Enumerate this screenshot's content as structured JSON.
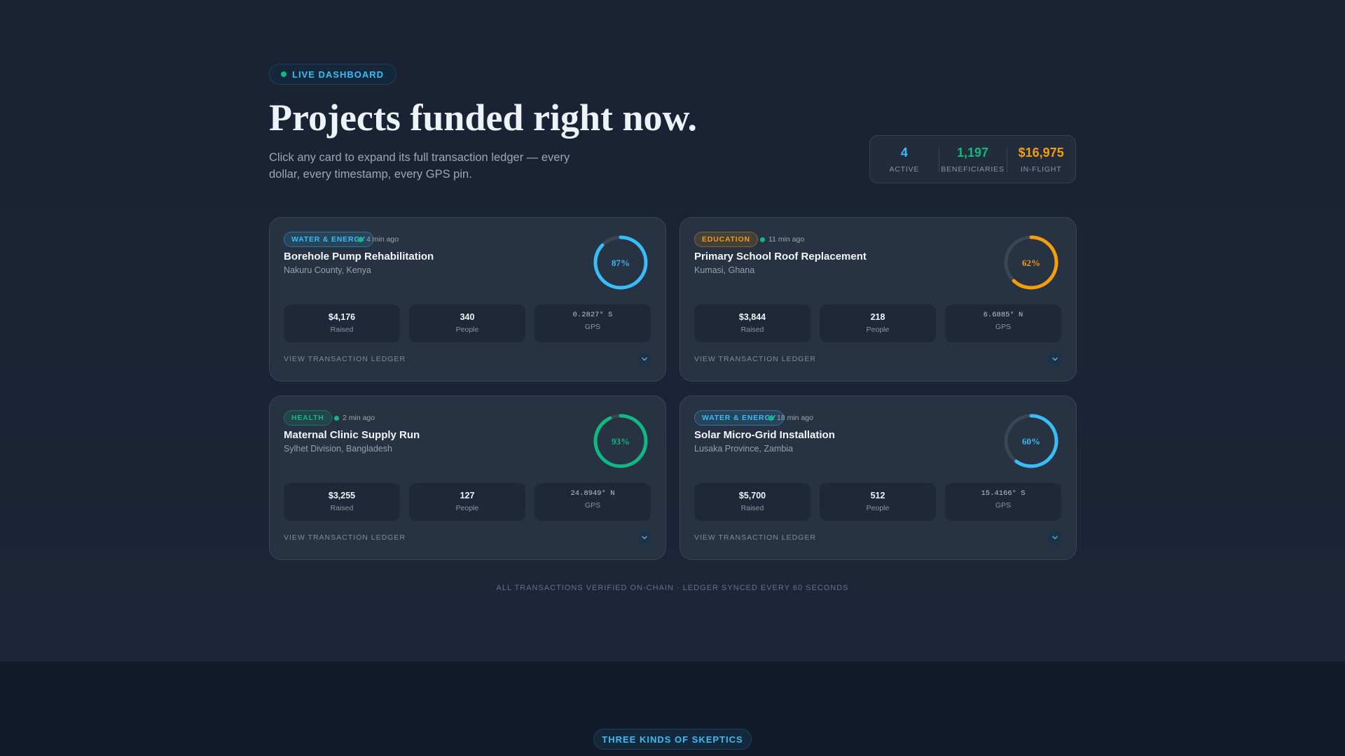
{
  "header": {
    "badge_label": "LIVE DASHBOARD",
    "title": "Projects funded right now.",
    "subtitle": "Click any card to expand its full transaction ledger — every dollar, every timestamp, every GPS pin."
  },
  "summary": [
    {
      "value": "4",
      "label": "ACTIVE",
      "color": "#38bdf8"
    },
    {
      "value": "1,197",
      "label": "BENEFICIARIES",
      "color": "#10b981"
    },
    {
      "value": "$16,975",
      "label": "IN-FLIGHT",
      "color": "#f59e0b"
    }
  ],
  "labels": {
    "raised": "Raised",
    "people": "People",
    "gps": "GPS",
    "ledger": "VIEW TRANSACTION LEDGER"
  },
  "cards": [
    {
      "tag": "WATER & ENERGY",
      "tag_color": "#38bdf8",
      "time": "4 min ago",
      "title": "Borehole Pump Rehabilitation",
      "location": "Nakuru County, Kenya",
      "progress_pct": 87,
      "progress_label": "87%",
      "ring_color": "#38bdf8",
      "raised": "$4,176",
      "people": "340",
      "gps": "0.2827° S"
    },
    {
      "tag": "EDUCATION",
      "tag_color": "#f59e0b",
      "time": "11 min ago",
      "title": "Primary School Roof Replacement",
      "location": "Kumasi, Ghana",
      "progress_pct": 62,
      "progress_label": "62%",
      "ring_color": "#f59e0b",
      "raised": "$3,844",
      "people": "218",
      "gps": "6.6885° N"
    },
    {
      "tag": "HEALTH",
      "tag_color": "#10b981",
      "time": "2 min ago",
      "title": "Maternal Clinic Supply Run",
      "location": "Sylhet Division, Bangladesh",
      "progress_pct": 93,
      "progress_label": "93%",
      "ring_color": "#10b981",
      "raised": "$3,255",
      "people": "127",
      "gps": "24.8949° N"
    },
    {
      "tag": "WATER & ENERGY",
      "tag_color": "#38bdf8",
      "time": "18 min ago",
      "title": "Solar Micro-Grid Installation",
      "location": "Lusaka Province, Zambia",
      "progress_pct": 60,
      "progress_label": "60%",
      "ring_color": "#38bdf8",
      "raised": "$5,700",
      "people": "512",
      "gps": "15.4166° S"
    }
  ],
  "footer": {
    "note": "ALL TRANSACTIONS VERIFIED ON-CHAIN · LEDGER SYNCED EVERY 60 SECONDS",
    "section_badge": "THREE KINDS OF SKEPTICS"
  },
  "colors": {
    "accent": "#38bdf8",
    "success": "#10b981",
    "warning": "#f59e0b"
  }
}
